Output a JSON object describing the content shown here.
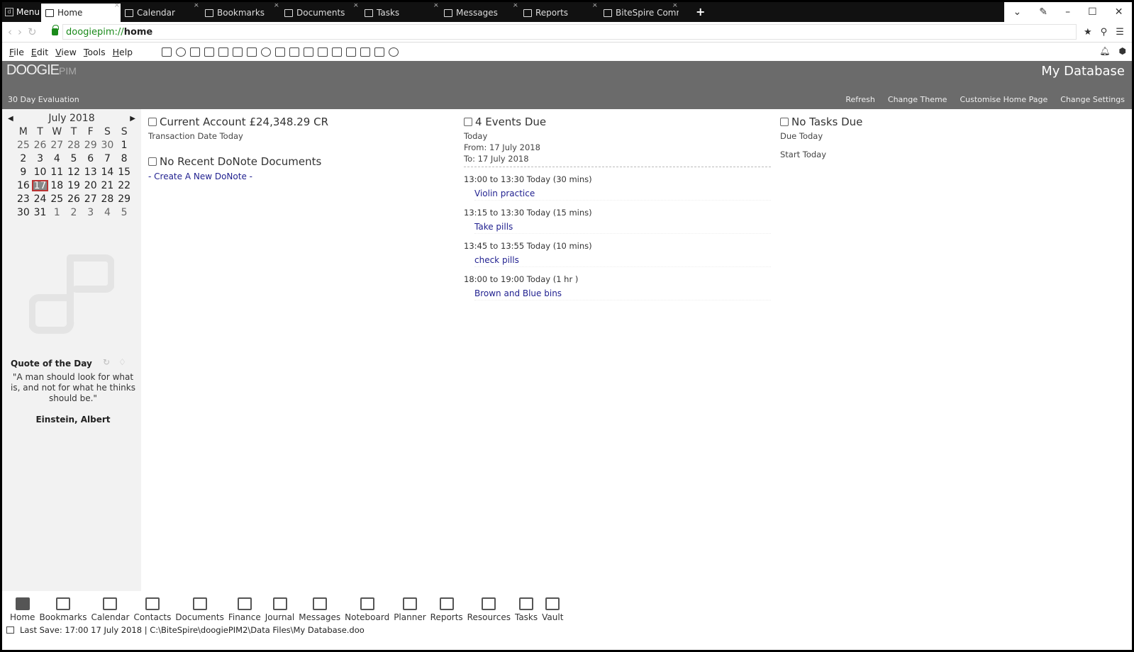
{
  "tabbar": {
    "menu_label": "Menu",
    "tabs": [
      {
        "label": "Home",
        "icon": "home-icon",
        "active": true
      },
      {
        "label": "Calendar",
        "icon": "calendar-icon"
      },
      {
        "label": "Bookmarks",
        "icon": "bookmark-icon"
      },
      {
        "label": "Documents",
        "icon": "document-icon"
      },
      {
        "label": "Tasks",
        "icon": "clipboard-icon"
      },
      {
        "label": "Messages",
        "icon": "envelope-icon"
      },
      {
        "label": "Reports",
        "icon": "folder-icon"
      },
      {
        "label": "BiteSpire Comm",
        "icon": "web-icon"
      }
    ],
    "new_tab": "+",
    "close_glyph": "×",
    "window_controls": {
      "minimize": "–",
      "maximize": "☐",
      "close": "✕"
    }
  },
  "address": {
    "protocol": "doogiepim://",
    "path": "home"
  },
  "menus": [
    "File",
    "Edit",
    "View",
    "Tools",
    "Help"
  ],
  "banner": {
    "brand": "DOOGIE",
    "brand_suffix": "PIM",
    "evaluation": "30 Day Evaluation",
    "database": "My Database",
    "links": [
      "Refresh",
      "Change Theme",
      "Customise Home Page",
      "Change Settings"
    ]
  },
  "calendar": {
    "month": "July 2018",
    "day_headers": [
      "M",
      "T",
      "W",
      "T",
      "F",
      "S",
      "S"
    ],
    "weeks": [
      [
        "25",
        "26",
        "27",
        "28",
        "29",
        "30",
        "1"
      ],
      [
        "2",
        "3",
        "4",
        "5",
        "6",
        "7",
        "8"
      ],
      [
        "9",
        "10",
        "11",
        "12",
        "13",
        "14",
        "15"
      ],
      [
        "16",
        "17",
        "18",
        "19",
        "20",
        "21",
        "22"
      ],
      [
        "23",
        "24",
        "25",
        "26",
        "27",
        "28",
        "29"
      ],
      [
        "30",
        "31",
        "1",
        "2",
        "3",
        "4",
        "5"
      ]
    ],
    "today": "17"
  },
  "quote": {
    "title": "Quote of the Day",
    "text": "\"A man should look for what is, and not for what he thinks should be.\"",
    "author": "Einstein, Albert"
  },
  "finance": {
    "heading": "Current Account £24,348.29 CR",
    "sub": "Transaction Date Today"
  },
  "donote": {
    "heading": "No Recent DoNote Documents",
    "link": "- Create A New DoNote -"
  },
  "events": {
    "heading": "4 Events Due",
    "range_label": "Today",
    "from": "From: 17 July 2018",
    "to": "To: 17 July 2018",
    "items": [
      {
        "time": "13:00 to 13:30 Today (30 mins)",
        "title": "Violin practice"
      },
      {
        "time": "13:15 to 13:30 Today (15 mins)",
        "title": "Take pills"
      },
      {
        "time": "13:45 to 13:55 Today (10 mins)",
        "title": "check pills"
      },
      {
        "time": "18:00 to 19:00 Today (1 hr )",
        "title": "Brown and Blue bins"
      }
    ]
  },
  "tasks": {
    "heading": "No Tasks Due",
    "due": "Due Today",
    "start": "Start Today"
  },
  "bottom_nav": [
    "Home",
    "Bookmarks",
    "Calendar",
    "Contacts",
    "Documents",
    "Finance",
    "Journal",
    "Messages",
    "Noteboard",
    "Planner",
    "Reports",
    "Resources",
    "Tasks",
    "Vault"
  ],
  "status": "Last Save: 17:00 17 July 2018 | C:\\BiteSpire\\doogiePIM2\\Data Files\\My Database.doo",
  "colors": {
    "banner": "#6b6b6b",
    "link": "#1f1f8f",
    "today_highlight": "#888888"
  }
}
